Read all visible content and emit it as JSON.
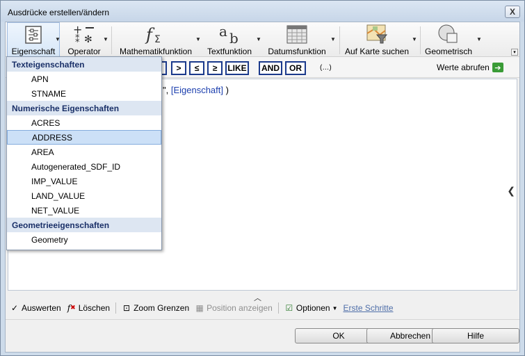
{
  "window": {
    "title": "Ausdrücke erstellen/ändern",
    "close_glyph": "X"
  },
  "toolbar": {
    "items": [
      {
        "label": "Eigenschaft",
        "icon": "property-icon"
      },
      {
        "label": "Operator",
        "icon": "operator-icon"
      },
      {
        "label": "Mathematikfunktion",
        "icon": "math-function-icon"
      },
      {
        "label": "Textfunktion",
        "icon": "text-function-icon"
      },
      {
        "label": "Datumsfunktion",
        "icon": "date-function-icon"
      },
      {
        "label": "Auf Karte suchen",
        "icon": "map-search-icon"
      },
      {
        "label": "Geometrisch",
        "icon": "geometric-icon"
      }
    ]
  },
  "operators": {
    "gt": ">",
    "le": "≤",
    "ge": "≥",
    "like": "LIKE",
    "and": "AND",
    "or": "OR",
    "parens": "(…)"
  },
  "fetch_values": {
    "label": "Werte abrufen"
  },
  "editor": {
    "prefix": "\", ",
    "token": "[Eigenschaft]",
    "suffix": " )"
  },
  "dropdown": {
    "groups": [
      {
        "header": "Texteigenschaften",
        "items": [
          "APN",
          "STNAME"
        ]
      },
      {
        "header": "Numerische Eigenschaften",
        "items": [
          "ACRES",
          "ADDRESS",
          "AREA",
          "Autogenerated_SDF_ID",
          "IMP_VALUE",
          "LAND_VALUE",
          "NET_VALUE"
        ]
      },
      {
        "header": "Geometrieeigenschaften",
        "items": [
          "Geometry"
        ]
      }
    ],
    "selected": "ADDRESS"
  },
  "bottombar": {
    "evaluate": "Auswerten",
    "delete": "Löschen",
    "zoom": "Zoom Grenzen",
    "show_position": "Position anzeigen",
    "options": "Optionen",
    "first_steps": "Erste Schritte"
  },
  "buttons": {
    "ok": "OK",
    "cancel": "Abbrechen",
    "help": "Hilfe"
  },
  "colors": {
    "header_text": "#1a3068",
    "selection": "#cce0f7",
    "token": "#1c3fae",
    "go_arrow": "#3a9b36"
  }
}
